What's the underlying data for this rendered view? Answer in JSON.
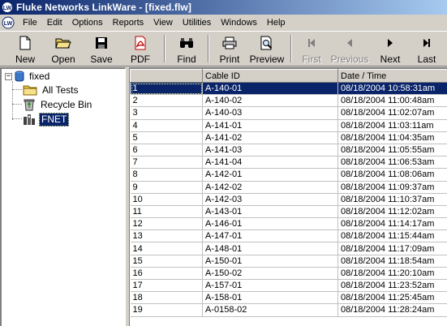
{
  "window": {
    "title": "Fluke Networks LinkWare - [fixed.flw]",
    "app_icon": "linkware-logo-icon"
  },
  "menu": [
    "File",
    "Edit",
    "Options",
    "Reports",
    "View",
    "Utilities",
    "Windows",
    "Help"
  ],
  "toolbar": {
    "new": {
      "label": "New",
      "icon": "new-document-icon",
      "enabled": true
    },
    "open": {
      "label": "Open",
      "icon": "open-folder-icon",
      "enabled": true
    },
    "save": {
      "label": "Save",
      "icon": "floppy-disk-icon",
      "enabled": true
    },
    "pdf": {
      "label": "PDF",
      "icon": "pdf-icon",
      "enabled": true
    },
    "find": {
      "label": "Find",
      "icon": "binoculars-icon",
      "enabled": true
    },
    "print": {
      "label": "Print",
      "icon": "printer-icon",
      "enabled": true
    },
    "preview": {
      "label": "Preview",
      "icon": "print-preview-icon",
      "enabled": true
    },
    "first": {
      "label": "First",
      "icon": "first-record-icon",
      "enabled": false
    },
    "previous": {
      "label": "Previous",
      "icon": "previous-record-icon",
      "enabled": false
    },
    "next": {
      "label": "Next",
      "icon": "next-record-icon",
      "enabled": true
    },
    "last": {
      "label": "Last",
      "icon": "last-record-icon",
      "enabled": true
    }
  },
  "tree": {
    "root": {
      "label": "fixed",
      "icon": "database-icon",
      "expander": "−"
    },
    "children": [
      {
        "label": "All Tests",
        "icon": "folder-icon"
      },
      {
        "label": "Recycle Bin",
        "icon": "recycle-bin-icon"
      },
      {
        "label": "FNET",
        "icon": "network-tester-icon",
        "selected": true
      }
    ]
  },
  "table": {
    "columns": [
      "",
      "Cable ID",
      "Date / Time"
    ],
    "selected_row": 0,
    "rows": [
      [
        "1",
        "A-140-01",
        "08/18/2004 10:58:31am"
      ],
      [
        "2",
        "A-140-02",
        "08/18/2004 11:00:48am"
      ],
      [
        "3",
        "A-140-03",
        "08/18/2004 11:02:07am"
      ],
      [
        "4",
        "A-141-01",
        "08/18/2004 11:03:11am"
      ],
      [
        "5",
        "A-141-02",
        "08/18/2004 11:04:35am"
      ],
      [
        "6",
        "A-141-03",
        "08/18/2004 11:05:55am"
      ],
      [
        "7",
        "A-141-04",
        "08/18/2004 11:06:53am"
      ],
      [
        "8",
        "A-142-01",
        "08/18/2004 11:08:06am"
      ],
      [
        "9",
        "A-142-02",
        "08/18/2004 11:09:37am"
      ],
      [
        "10",
        "A-142-03",
        "08/18/2004 11:10:37am"
      ],
      [
        "11",
        "A-143-01",
        "08/18/2004 11:12:02am"
      ],
      [
        "12",
        "A-146-01",
        "08/18/2004 11:14:17am"
      ],
      [
        "13",
        "A-147-01",
        "08/18/2004 11:15:44am"
      ],
      [
        "14",
        "A-148-01",
        "08/18/2004 11:17:09am"
      ],
      [
        "15",
        "A-150-01",
        "08/18/2004 11:18:54am"
      ],
      [
        "16",
        "A-150-02",
        "08/18/2004 11:20:10am"
      ],
      [
        "17",
        "A-157-01",
        "08/18/2004 11:23:52am"
      ],
      [
        "18",
        "A-158-01",
        "08/18/2004 11:25:45am"
      ],
      [
        "19",
        "A-0158-02",
        "08/18/2004 11:28:24am"
      ]
    ]
  }
}
